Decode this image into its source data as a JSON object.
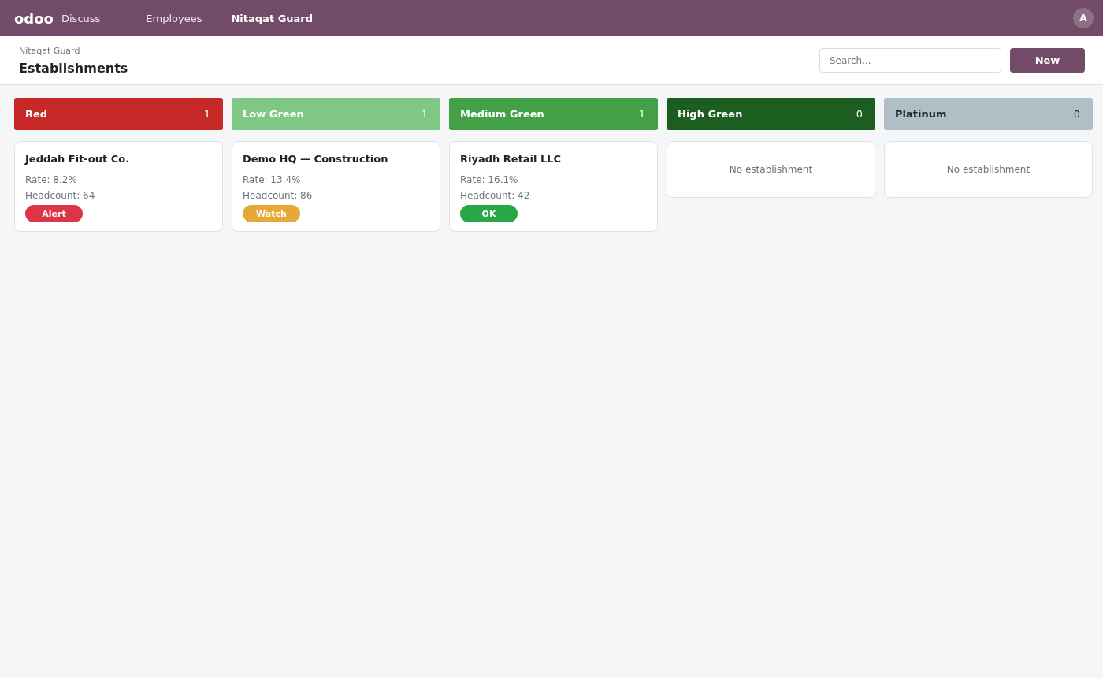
{
  "navbar": {
    "brand": "odoo",
    "menu": [
      {
        "label": "Discuss",
        "selected": false
      },
      {
        "label": "Employees",
        "selected": false
      },
      {
        "label": "Nitaqat Guard",
        "selected": true
      }
    ],
    "avatar": "A"
  },
  "control_panel": {
    "breadcrumb": "Nitaqat Guard",
    "title": "Establishments",
    "search": {
      "placeholder": "Search..."
    },
    "new_button": "New"
  },
  "columns": [
    {
      "title": "Red",
      "count": "1",
      "color": "#c62828",
      "cards": [
        {
          "name": "Jeddah Fit-out Co.",
          "rate": "Rate: 8.2%",
          "headcount": "Headcount: 64",
          "badge": {
            "label": "Alert",
            "color": "#dc3545"
          }
        }
      ]
    },
    {
      "title": "Low Green",
      "count": "1",
      "color": "#81c784",
      "cards": [
        {
          "name": "Demo HQ — Construction",
          "rate": "Rate: 13.4%",
          "headcount": "Headcount: 86",
          "badge": {
            "label": "Watch",
            "color": "#e8a838"
          }
        }
      ]
    },
    {
      "title": "Medium Green",
      "count": "1",
      "color": "#43a047",
      "cards": [
        {
          "name": "Riyadh Retail LLC",
          "rate": "Rate: 16.1%",
          "headcount": "Headcount: 42",
          "badge": {
            "label": "OK",
            "color": "#28a745"
          }
        }
      ]
    },
    {
      "title": "High Green",
      "count": "0",
      "color": "#1b5e20",
      "empty_text": "No establishment"
    },
    {
      "title": "Platinum",
      "count": "0",
      "color": "#b0bec5",
      "empty_text": "No establishment"
    }
  ]
}
